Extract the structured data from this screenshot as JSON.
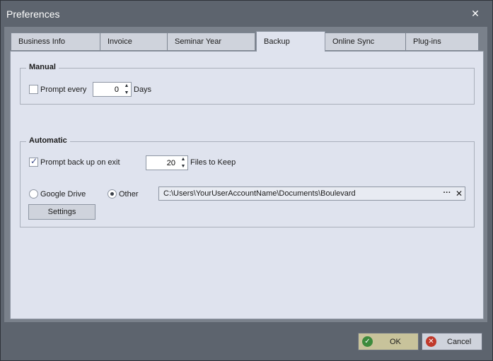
{
  "window": {
    "title": "Preferences"
  },
  "tabs": [
    {
      "label": "Business Info"
    },
    {
      "label": "Invoice"
    },
    {
      "label": "Seminar Year"
    },
    {
      "label": "Backup"
    },
    {
      "label": "Online Sync"
    },
    {
      "label": "Plug-ins"
    }
  ],
  "active_tab": "Backup",
  "manual": {
    "title": "Manual",
    "prompt_every_label": "Prompt every",
    "prompt_every_checked": false,
    "prompt_every_value": "0",
    "days_label": "Days"
  },
  "automatic": {
    "title": "Automatic",
    "prompt_on_exit_label": "Prompt back up on exit",
    "prompt_on_exit_checked": true,
    "files_value": "20",
    "files_label": "Files to Keep",
    "google_drive_label": "Google Drive",
    "other_label": "Other",
    "selected_location": "Other",
    "path_value": "C:\\Users\\YourUserAccountName\\Documents\\Boulevard",
    "browse_glyph": "···",
    "clear_glyph": "✕",
    "settings_label": "Settings"
  },
  "footer": {
    "ok_label": "OK",
    "cancel_label": "Cancel"
  },
  "icons": {
    "ok": "check-circle-icon",
    "cancel": "x-circle-icon",
    "close": "close-icon"
  },
  "colors": {
    "ok_button_bg": "#c8c39b",
    "ok_icon": "#3c8a3c",
    "cancel_icon": "#c0392b"
  }
}
